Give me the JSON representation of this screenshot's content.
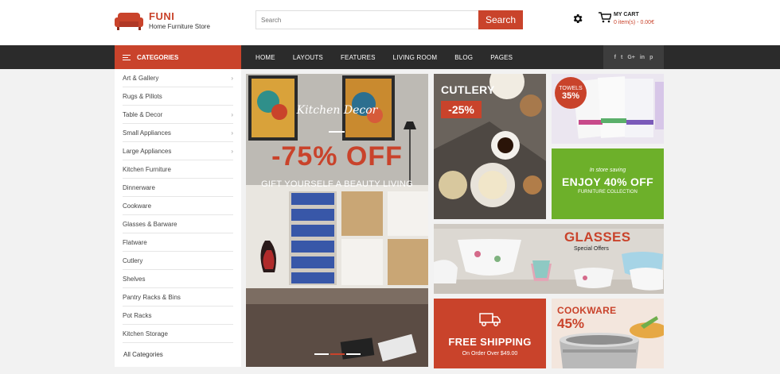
{
  "header": {
    "brand": "FUNI",
    "tagline": "Home Furniture Store",
    "search_placeholder": "Search",
    "search_button": "Search",
    "cart_title": "MY CART",
    "cart_summary": "0 item(s) - 0.00€"
  },
  "nav": {
    "categories_label": "CATEGORIES",
    "menu": [
      "HOME",
      "LAYOUTS",
      "FEATURES",
      "LIVING ROOM",
      "BLOG",
      "PAGES"
    ],
    "social": [
      "f",
      "t",
      "G+",
      "in",
      "p"
    ]
  },
  "sidebar": {
    "items": [
      {
        "label": "Art & Gallery",
        "arrow": true
      },
      {
        "label": "Rugs & Pillots",
        "arrow": false
      },
      {
        "label": "Table & Decor",
        "arrow": true
      },
      {
        "label": "Small Appliances",
        "arrow": true
      },
      {
        "label": "Large Appliances",
        "arrow": true
      },
      {
        "label": "Kitchen Furniture",
        "arrow": false
      },
      {
        "label": "Dinnerware",
        "arrow": false
      },
      {
        "label": "Cookware",
        "arrow": false
      },
      {
        "label": "Glasses & Barware",
        "arrow": false
      },
      {
        "label": "Flatware",
        "arrow": false
      },
      {
        "label": "Cutlery",
        "arrow": false
      },
      {
        "label": "Shelves",
        "arrow": false
      },
      {
        "label": "Pantry Racks & Bins",
        "arrow": false
      },
      {
        "label": "Pot Racks",
        "arrow": false
      },
      {
        "label": "Kitchen Storage",
        "arrow": false
      }
    ],
    "all_label": "All Categories"
  },
  "hero": {
    "title": "Kitchen Decor",
    "discount": "-75% OFF",
    "subtitle": "GIFT YOURSELF A BEAUTY LIVING"
  },
  "banners": {
    "cutlery": {
      "title": "CUTLERY",
      "discount": "-25%"
    },
    "towels": {
      "title": "TOWELS",
      "discount": "35%"
    },
    "enjoy": {
      "line1": "In store saving",
      "line2": "ENJOY 40% OFF",
      "line3": "FURNITURE COLLECTION"
    },
    "glasses": {
      "title": "GLASSES",
      "subtitle": "Special Offers"
    },
    "shipping": {
      "title": "FREE SHIPPING",
      "subtitle": "On Order Over $49.00"
    },
    "cookware": {
      "title": "COOKWARE",
      "discount": "45%"
    }
  },
  "colors": {
    "accent": "#c9432b",
    "dark_nav": "#2b2b2b",
    "green": "#6db02a"
  }
}
